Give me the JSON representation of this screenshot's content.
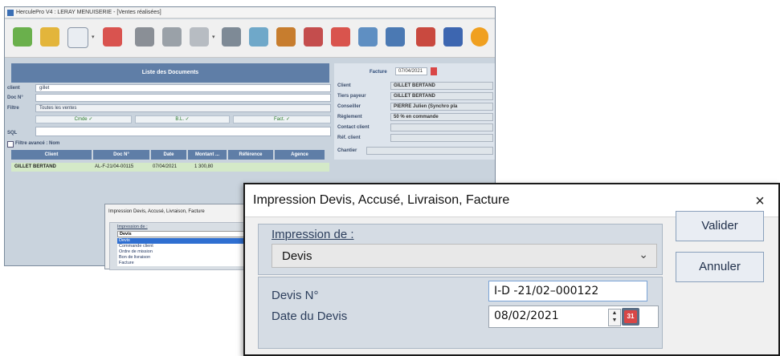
{
  "background_window": {
    "title": "HerculePro V4 : LERAY MENUISERIE - [Ventes réalisées]",
    "list_panel_title": "Liste des Documents",
    "fields": [
      {
        "label": "client",
        "value": "gillet"
      },
      {
        "label": "Doc N°",
        "value": ""
      },
      {
        "label": "Filtre",
        "value": "Toutes les ventes"
      }
    ],
    "checks": [
      "Cmde ✓",
      "B.L. ✓",
      "Fact. ✓"
    ],
    "sql_label": "SQL",
    "advanced_filter": "Filtre avancé : Nom",
    "columns": [
      "Client",
      "Doc N°",
      "Date",
      "Montant ...",
      "Référence",
      "Agence"
    ],
    "row": {
      "client": "GILLET BERTAND",
      "doc": "AL-F-21/04-00115",
      "date": "07/04/2021",
      "amount": "1 300,80"
    },
    "right_panel": {
      "doc_type": "Facture",
      "doc_date": "07/04/2021",
      "rows": [
        {
          "label": "Client",
          "value": "GILLET BERTAND"
        },
        {
          "label": "Tiers payeur",
          "value": "GILLET BERTAND"
        },
        {
          "label": "Conseiller",
          "value": "PIERRE Julien (Synchro pla"
        },
        {
          "label": "Règlement",
          "value": "50 % en commande"
        },
        {
          "label": "Contact client",
          "value": ""
        },
        {
          "label": "Réf. client",
          "value": ""
        },
        {
          "label": "Chantier",
          "value": ""
        }
      ]
    },
    "small_dialog": {
      "title": "Impression Devis, Accusé, Livraison, Facture",
      "group_label": "Impression de :",
      "selected": "Devis",
      "options": [
        "Devis",
        "Commande client",
        "Ordre de mission",
        "Bon de livraison",
        "Facture"
      ]
    }
  },
  "dialog": {
    "title": "Impression Devis, Accusé, Livraison, Facture",
    "print_of_label": "Impression de :",
    "print_of_value": "Devis",
    "number_label": "Devis N°",
    "number_value": "I-D -21/02–000122",
    "date_label": "Date du Devis",
    "date_value": "08/02/2021",
    "validate_label": "Valider",
    "cancel_label": "Annuler",
    "close_glyph": "×"
  }
}
